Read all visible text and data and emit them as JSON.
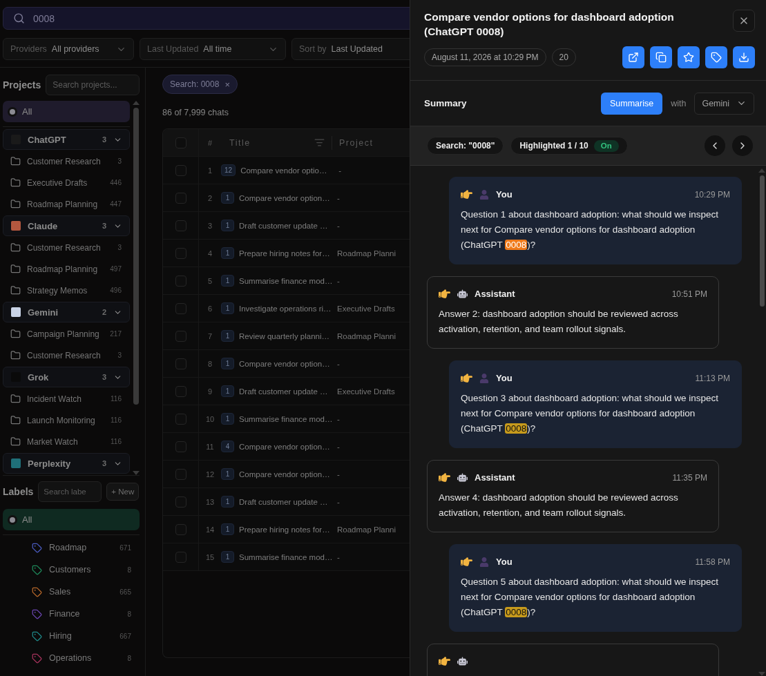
{
  "search": {
    "value": "0008"
  },
  "filters": [
    {
      "label": "Providers",
      "value": "All providers"
    },
    {
      "label": "Last Updated",
      "value": "All time"
    },
    {
      "label": "Sort by",
      "value": "Last Updated"
    }
  ],
  "projects": {
    "title": "Projects",
    "placeholder": "Search projects...",
    "all": {
      "label": "All",
      "selected": true
    },
    "providers": [
      {
        "name": "ChatGPT",
        "count": "3",
        "expanded": true,
        "color": "#1a1a1a",
        "children": [
          {
            "name": "Customer Research",
            "count": "3"
          },
          {
            "name": "Executive Drafts",
            "count": "446"
          },
          {
            "name": "Roadmap Planning",
            "count": "447"
          }
        ]
      },
      {
        "name": "Claude",
        "count": "3",
        "expanded": true,
        "color": "#b4583f",
        "children": [
          {
            "name": "Customer Research",
            "count": "3"
          },
          {
            "name": "Roadmap Planning",
            "count": "497"
          },
          {
            "name": "Strategy Memos",
            "count": "496"
          }
        ]
      },
      {
        "name": "Gemini",
        "count": "2",
        "expanded": true,
        "color": "#c9d3e6",
        "children": [
          {
            "name": "Campaign Planning",
            "count": "217"
          },
          {
            "name": "Customer Research",
            "count": "3"
          }
        ]
      },
      {
        "name": "Grok",
        "count": "3",
        "expanded": true,
        "color": "#0a0a0a",
        "children": [
          {
            "name": "Incident Watch",
            "count": "116"
          },
          {
            "name": "Launch Monitoring",
            "count": "116"
          },
          {
            "name": "Market Watch",
            "count": "116"
          }
        ]
      },
      {
        "name": "Perplexity",
        "count": "3",
        "expanded": true,
        "color": "#1f6f78"
      }
    ]
  },
  "labels": {
    "title": "Labels",
    "placeholder": "Search labe",
    "new_button": "+ New",
    "all": {
      "label": "All",
      "selected": true
    },
    "items": [
      {
        "name": "Roadmap",
        "count": "671",
        "color": "#4a5bbf"
      },
      {
        "name": "Customers",
        "count": "8",
        "color": "#1f8a5b"
      },
      {
        "name": "Sales",
        "count": "665",
        "color": "#b8682a"
      },
      {
        "name": "Finance",
        "count": "8",
        "color": "#6a45b0"
      },
      {
        "name": "Hiring",
        "count": "667",
        "color": "#1f8a8a"
      },
      {
        "name": "Operations",
        "count": "8",
        "color": "#a8335d"
      }
    ]
  },
  "chip": {
    "label": "Search: 0008",
    "close": "×"
  },
  "result_count": "86 of 7,999 chats",
  "table": {
    "columns": [
      "#",
      "Title",
      "Project"
    ],
    "select_all_checked": false,
    "rows": [
      {
        "num": "1",
        "count": "12",
        "title": "Compare vendor optio…",
        "project": "-",
        "checked": false
      },
      {
        "num": "2",
        "count": "1",
        "title": "Compare vendor option…",
        "project": "-",
        "checked": false
      },
      {
        "num": "3",
        "count": "1",
        "title": "Draft customer update …",
        "project": "-",
        "checked": false
      },
      {
        "num": "4",
        "count": "1",
        "title": "Prepare hiring notes for…",
        "project": "Roadmap Planni",
        "checked": false
      },
      {
        "num": "5",
        "count": "1",
        "title": "Summarise finance mod…",
        "project": "-",
        "checked": false
      },
      {
        "num": "6",
        "count": "1",
        "title": "Investigate operations ri…",
        "project": "Executive Drafts",
        "checked": false
      },
      {
        "num": "7",
        "count": "1",
        "title": "Review quarterly planni…",
        "project": "Roadmap Planni",
        "checked": false
      },
      {
        "num": "8",
        "count": "1",
        "title": "Compare vendor option…",
        "project": "-",
        "checked": false
      },
      {
        "num": "9",
        "count": "1",
        "title": "Draft customer update …",
        "project": "Executive Drafts",
        "checked": false
      },
      {
        "num": "10",
        "count": "1",
        "title": "Summarise finance mod…",
        "project": "-",
        "checked": false
      },
      {
        "num": "11",
        "count": "4",
        "title": "Compare vendor option…",
        "project": "-",
        "checked": false
      },
      {
        "num": "12",
        "count": "1",
        "title": "Compare vendor option…",
        "project": "-",
        "checked": false
      },
      {
        "num": "13",
        "count": "1",
        "title": "Draft customer update …",
        "project": "-",
        "checked": false
      },
      {
        "num": "14",
        "count": "1",
        "title": "Prepare hiring notes for…",
        "project": "Roadmap Planni",
        "checked": false
      },
      {
        "num": "15",
        "count": "1",
        "title": "Summarise finance mod…",
        "project": "-",
        "checked": false
      }
    ]
  },
  "drawer": {
    "title": "Compare vendor options for dashboard adoption (ChatGPT 0008)",
    "date": "August 11, 2026 at 10:29 PM",
    "message_count": "20",
    "summary": {
      "title": "Summary",
      "button": "Summarise",
      "with": "with",
      "model": "Gemini"
    },
    "find": {
      "search": "Search: \"0008\"",
      "highlighted": "Highlighted 1 / 10",
      "toggle": "On",
      "on": true
    },
    "messages": [
      {
        "kind": "user",
        "author": "You",
        "time": "10:29 PM",
        "text": "Question 1 about dashboard adoption: what should we inspect next for Compare vendor options for dashboard adoption (ChatGPT ",
        "match": "0008",
        "after": ")?",
        "current": true
      },
      {
        "kind": "assistant",
        "author": "Assistant",
        "time": "10:51 PM",
        "text": "Answer 2: dashboard adoption should be reviewed across activation, retention, and team rollout signals."
      },
      {
        "kind": "user",
        "author": "You",
        "time": "11:13 PM",
        "text": "Question 3 about dashboard adoption: what should we inspect next for Compare vendor options for dashboard adoption (ChatGPT ",
        "match": "0008",
        "after": ")?",
        "current": false
      },
      {
        "kind": "assistant",
        "author": "Assistant",
        "time": "11:35 PM",
        "text": "Answer 4: dashboard adoption should be reviewed across activation, retention, and team rollout signals."
      },
      {
        "kind": "user",
        "author": "You",
        "time": "11:58 PM",
        "text": "Question 5 about dashboard adoption: what should we inspect next for Compare vendor options for dashboard adoption (ChatGPT ",
        "match": "0008",
        "after": ")?",
        "current": false
      }
    ]
  }
}
